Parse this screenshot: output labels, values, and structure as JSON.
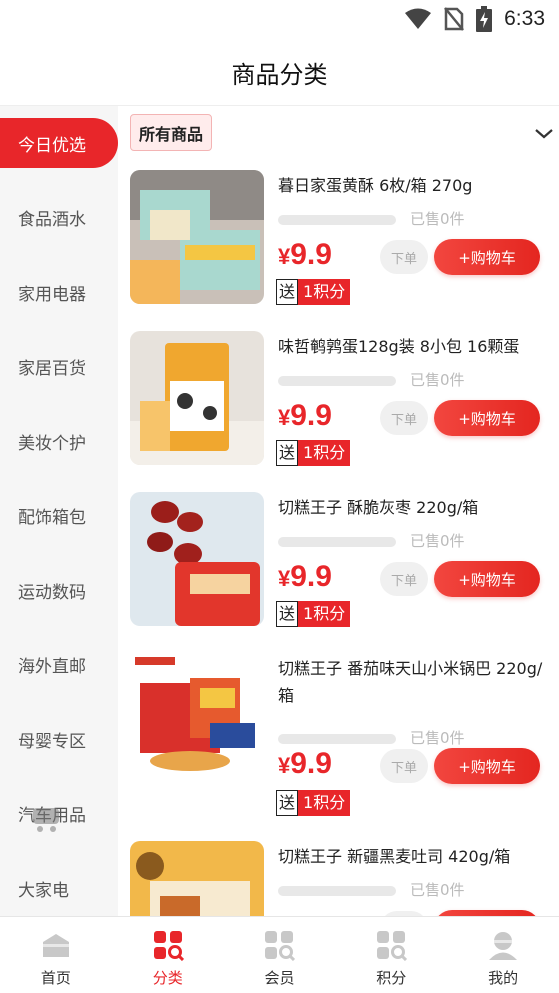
{
  "status_bar": {
    "time": "6:33",
    "icons": [
      "wifi-icon",
      "no-sim-icon",
      "battery-charging-icon"
    ]
  },
  "header": {
    "title": "商品分类"
  },
  "sidebar": {
    "items": [
      {
        "label": "今日优选",
        "active": true
      },
      {
        "label": "食品酒水",
        "active": false
      },
      {
        "label": "家用电器",
        "active": false
      },
      {
        "label": "家居百货",
        "active": false
      },
      {
        "label": "美妆个护",
        "active": false
      },
      {
        "label": "配饰箱包",
        "active": false
      },
      {
        "label": "运动数码",
        "active": false
      },
      {
        "label": "海外直邮",
        "active": false
      },
      {
        "label": "母婴专区",
        "active": false
      },
      {
        "label": "汽车用品",
        "active": false
      },
      {
        "label": "大家电",
        "active": false
      }
    ]
  },
  "filter": {
    "selected_label": "所有商品"
  },
  "products": [
    {
      "name": "暮日家蛋黄酥 6枚/箱 270g",
      "sold": "已售0件",
      "price_symbol": "¥",
      "price": "9.9",
      "order_label": "下单",
      "cart_label": "+购物车",
      "gift_label": "送",
      "points_label": "1积分"
    },
    {
      "name": "味哲鹌鹑蛋128g装 8小包 16颗蛋",
      "sold": "已售0件",
      "price_symbol": "¥",
      "price": "9.9",
      "order_label": "下单",
      "cart_label": "+购物车",
      "gift_label": "送",
      "points_label": "1积分"
    },
    {
      "name": "切糕王子 酥脆灰枣 220g/箱",
      "sold": "已售0件",
      "price_symbol": "¥",
      "price": "9.9",
      "order_label": "下单",
      "cart_label": "+购物车",
      "gift_label": "送",
      "points_label": "1积分"
    },
    {
      "name": "切糕王子 番茄味天山小米锅巴 220g/箱",
      "sold": "已售0件",
      "price_symbol": "¥",
      "price": "9.9",
      "order_label": "下单",
      "cart_label": "+购物车",
      "gift_label": "送",
      "points_label": "1积分"
    },
    {
      "name": "切糕王子 新疆黑麦吐司 420g/箱",
      "sold": "已售0件"
    }
  ],
  "bottom_nav": {
    "items": [
      {
        "label": "首页",
        "icon": "home-icon",
        "active": false
      },
      {
        "label": "分类",
        "icon": "category-icon",
        "active": true
      },
      {
        "label": "会员",
        "icon": "member-icon",
        "active": false
      },
      {
        "label": "积分",
        "icon": "points-icon",
        "active": false
      },
      {
        "label": "我的",
        "icon": "profile-icon",
        "active": false
      }
    ]
  },
  "colors": {
    "accent": "#e8262a",
    "sidebar_bg": "#f6f6f6",
    "muted": "#bbbbbb"
  }
}
